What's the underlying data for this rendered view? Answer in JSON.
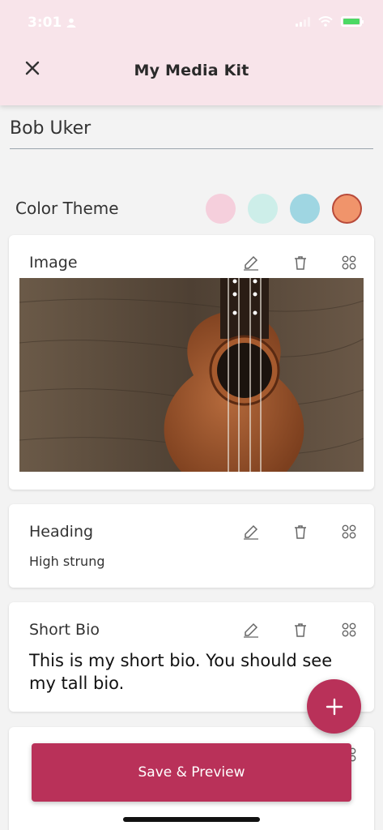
{
  "status_bar": {
    "time": "3:01"
  },
  "header": {
    "title": "My Media Kit"
  },
  "name_field": {
    "value": "Bob Uker"
  },
  "color_theme": {
    "label": "Color Theme",
    "swatches": [
      "#f5cfdc",
      "#cdeee9",
      "#9fd6e2",
      "#f0946b"
    ],
    "selected_index": 3
  },
  "cards": [
    {
      "title": "Image"
    },
    {
      "title": "Heading",
      "text": "High strung"
    },
    {
      "title": "Short Bio",
      "text": "This is my short bio. You should see my tall bio."
    }
  ],
  "save_button": {
    "label": "Save & Preview"
  },
  "colors": {
    "accent": "#b93159",
    "header_bg": "#f8e4ea"
  }
}
